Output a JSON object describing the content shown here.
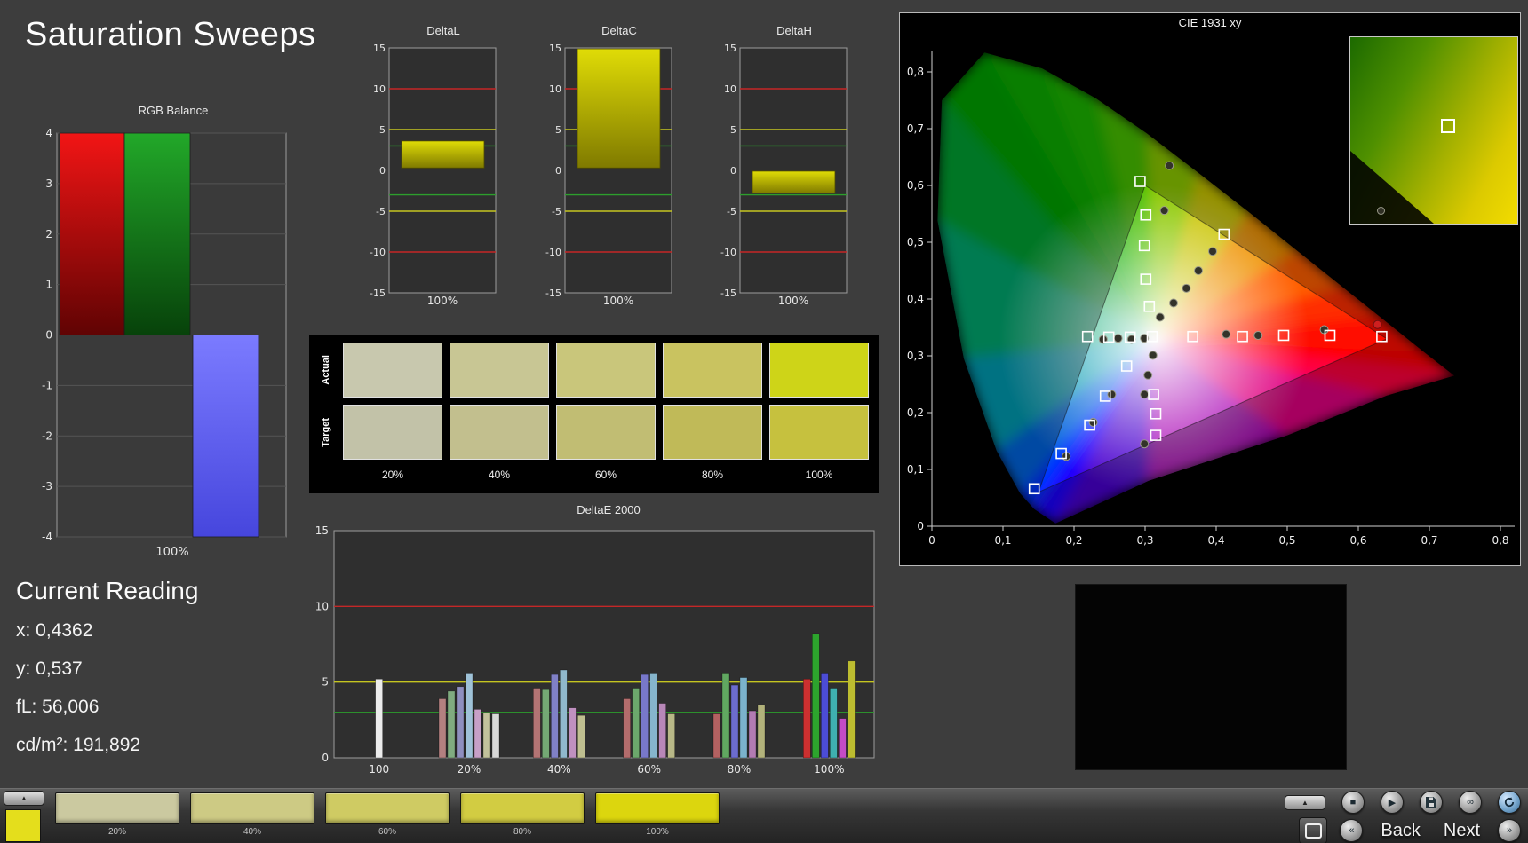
{
  "title": "Saturation Sweeps",
  "current_reading": {
    "heading": "Current Reading",
    "lines": [
      "x: 0,4362",
      "y: 0,537",
      "fL: 56,006",
      "cd/m²: 191,892"
    ]
  },
  "swatch_panel": {
    "row_labels": [
      "Actual",
      "Target"
    ],
    "columns": [
      "20%",
      "40%",
      "60%",
      "80%",
      "100%"
    ],
    "actual_colors": [
      "#c8c8ae",
      "#c8c694",
      "#c9c67b",
      "#c9c360",
      "#ced418"
    ],
    "target_colors": [
      "#c2c2a8",
      "#c2bf8e",
      "#c1bd73",
      "#c0ba58",
      "#c6c13e"
    ]
  },
  "toolbar": {
    "strip_swatches": [
      {
        "label": "20%",
        "color": "#cbc9a0"
      },
      {
        "label": "40%",
        "color": "#cdca84"
      },
      {
        "label": "60%",
        "color": "#cfcb63"
      },
      {
        "label": "80%",
        "color": "#d2cc42"
      },
      {
        "label": "100%",
        "color": "#dcd60e"
      }
    ],
    "selected_color": "#e4de1c",
    "back_label": "Back",
    "next_label": "Next",
    "icons": {
      "eject": "▲",
      "stop": "■",
      "play": "▶",
      "infinity": "∞",
      "back": "«",
      "next": "»"
    },
    "button_names": [
      "eject",
      "stop",
      "play",
      "save",
      "loop",
      "refresh",
      "pattern-window",
      "back",
      "next"
    ]
  },
  "chart_data": [
    {
      "id": "rgb_balance",
      "type": "bar",
      "title": "RGB Balance",
      "categories": [
        "100%"
      ],
      "series": [
        {
          "name": "Red",
          "values": [
            4
          ],
          "color": "#cc1111"
        },
        {
          "name": "Green",
          "values": [
            4
          ],
          "color": "#1a9122"
        },
        {
          "name": "Blue",
          "values": [
            -4
          ],
          "color": "#5a5aff"
        }
      ],
      "ylim": [
        -4,
        4
      ],
      "yticks": [
        4,
        3,
        2,
        1,
        0,
        -1,
        -2,
        -3,
        -4
      ]
    },
    {
      "id": "delta_l",
      "type": "bar",
      "title": "DeltaL",
      "categories": [
        "100%"
      ],
      "value": 3.6,
      "bar_from": 0.3,
      "bar_color": "#c9c400",
      "ylim": [
        -15,
        15
      ],
      "yticks": [
        15,
        10,
        5,
        0,
        -5,
        -10,
        -15
      ],
      "ref_lines": [
        {
          "y": 10,
          "color": "#c52727"
        },
        {
          "y": 5,
          "color": "#c5c520"
        },
        {
          "y": 3,
          "color": "#2d9e2d"
        },
        {
          "y": -3,
          "color": "#2d9e2d"
        },
        {
          "y": -5,
          "color": "#c5c520"
        },
        {
          "y": -10,
          "color": "#c52727"
        }
      ]
    },
    {
      "id": "delta_c",
      "type": "bar",
      "title": "DeltaC",
      "categories": [
        "100%"
      ],
      "value": 16,
      "bar_from": 0.3,
      "bar_color": "#c9c400",
      "ylim": [
        -15,
        15
      ],
      "yticks": [
        15,
        10,
        5,
        0,
        -5,
        -10,
        -15
      ],
      "ref_lines": [
        {
          "y": 10,
          "color": "#c52727"
        },
        {
          "y": 5,
          "color": "#c5c520"
        },
        {
          "y": 3,
          "color": "#2d9e2d"
        },
        {
          "y": -3,
          "color": "#2d9e2d"
        },
        {
          "y": -5,
          "color": "#c5c520"
        },
        {
          "y": -10,
          "color": "#c52727"
        }
      ]
    },
    {
      "id": "delta_h",
      "type": "bar",
      "title": "DeltaH",
      "categories": [
        "100%"
      ],
      "value": -2.8,
      "bar_from": -0.1,
      "bar_color": "#c9c400",
      "ylim": [
        -15,
        15
      ],
      "yticks": [
        15,
        10,
        5,
        0,
        -5,
        -10,
        -15
      ],
      "ref_lines": [
        {
          "y": 10,
          "color": "#c52727"
        },
        {
          "y": 5,
          "color": "#c5c520"
        },
        {
          "y": 3,
          "color": "#2d9e2d"
        },
        {
          "y": -3,
          "color": "#2d9e2d"
        },
        {
          "y": -5,
          "color": "#c5c520"
        },
        {
          "y": -10,
          "color": "#c52727"
        }
      ]
    },
    {
      "id": "deltae2000",
      "type": "bar",
      "title": "DeltaE 2000",
      "ylim": [
        0,
        15
      ],
      "yticks": [
        0,
        5,
        10,
        15
      ],
      "ref_lines": [
        {
          "y": 10,
          "color": "#c52727"
        },
        {
          "y": 5,
          "color": "#c5c520"
        },
        {
          "y": 3,
          "color": "#2d9e2d"
        }
      ],
      "groups": [
        {
          "label": "100",
          "bars": [
            [
              5.2,
              "#ececec"
            ]
          ]
        },
        {
          "label": "20%",
          "bars": [
            [
              3.9,
              "#b38080"
            ],
            [
              4.4,
              "#80ab80"
            ],
            [
              4.7,
              "#8f8fbf"
            ],
            [
              5.6,
              "#9fc2d8"
            ],
            [
              3.2,
              "#c7a0c7"
            ],
            [
              3.0,
              "#c2c29c"
            ],
            [
              2.9,
              "#d8d8d8"
            ]
          ]
        },
        {
          "label": "40%",
          "bars": [
            [
              4.6,
              "#b37474"
            ],
            [
              4.5,
              "#74a874"
            ],
            [
              5.5,
              "#8080c6"
            ],
            [
              5.8,
              "#90b8cc"
            ],
            [
              3.3,
              "#bf90bf"
            ],
            [
              2.8,
              "#bfbf90"
            ]
          ]
        },
        {
          "label": "60%",
          "bars": [
            [
              3.9,
              "#b36c6c"
            ],
            [
              4.6,
              "#6ca86c"
            ],
            [
              5.5,
              "#7878ca"
            ],
            [
              5.6,
              "#86b5cc"
            ],
            [
              3.6,
              "#b887b8"
            ],
            [
              2.9,
              "#b8b887"
            ]
          ]
        },
        {
          "label": "80%",
          "bars": [
            [
              2.9,
              "#b36161"
            ],
            [
              5.6,
              "#61a861"
            ],
            [
              4.8,
              "#6c6cce"
            ],
            [
              5.3,
              "#7bb2cc"
            ],
            [
              3.1,
              "#b27bb2"
            ],
            [
              3.5,
              "#b2b27b"
            ]
          ]
        },
        {
          "label": "100%",
          "bars": [
            [
              5.2,
              "#cc3030"
            ],
            [
              8.2,
              "#2da42d"
            ],
            [
              5.6,
              "#4c4cd6"
            ],
            [
              4.6,
              "#3fb0b0"
            ],
            [
              2.6,
              "#c44cc4"
            ],
            [
              6.4,
              "#bdbd30"
            ]
          ]
        }
      ]
    },
    {
      "id": "cie1931",
      "type": "scatter",
      "title": "CIE 1931 xy",
      "xlim": [
        0,
        0.8
      ],
      "ylim": [
        0,
        0.8
      ],
      "xticks": [
        "0",
        "0,1",
        "0,2",
        "0,3",
        "0,4",
        "0,5",
        "0,6",
        "0,7",
        "0,8"
      ],
      "yticks": [
        "0",
        "0,1",
        "0,2",
        "0,3",
        "0,4",
        "0,5",
        "0,6",
        "0,7",
        "0,8"
      ],
      "gamut_triangle": [
        [
          0.64,
          0.33
        ],
        [
          0.3,
          0.6
        ],
        [
          0.15,
          0.06
        ]
      ],
      "white_point": [
        0.3127,
        0.329
      ],
      "targets": [
        [
          0.293,
          0.607
        ],
        [
          0.301,
          0.548
        ],
        [
          0.299,
          0.494
        ],
        [
          0.301,
          0.435
        ],
        [
          0.306,
          0.387
        ],
        [
          0.219,
          0.334
        ],
        [
          0.249,
          0.333
        ],
        [
          0.279,
          0.333
        ],
        [
          0.31,
          0.334
        ],
        [
          0.367,
          0.334
        ],
        [
          0.437,
          0.334
        ],
        [
          0.495,
          0.336
        ],
        [
          0.56,
          0.336
        ],
        [
          0.633,
          0.334
        ],
        [
          0.411,
          0.514
        ],
        [
          0.274,
          0.282
        ],
        [
          0.312,
          0.232
        ],
        [
          0.315,
          0.198
        ],
        [
          0.244,
          0.229
        ],
        [
          0.222,
          0.178
        ],
        [
          0.182,
          0.128
        ],
        [
          0.144,
          0.066
        ],
        [
          0.315,
          0.16
        ]
      ],
      "measured": [
        [
          0.334,
          0.635
        ],
        [
          0.327,
          0.556
        ],
        [
          0.395,
          0.484
        ],
        [
          0.375,
          0.45
        ],
        [
          0.358,
          0.419
        ],
        [
          0.34,
          0.393
        ],
        [
          0.321,
          0.368
        ],
        [
          0.414,
          0.338
        ],
        [
          0.459,
          0.336
        ],
        [
          0.552,
          0.346
        ],
        [
          0.241,
          0.329
        ],
        [
          0.262,
          0.331
        ],
        [
          0.281,
          0.329
        ],
        [
          0.299,
          0.331
        ],
        [
          0.311,
          0.301
        ],
        [
          0.304,
          0.266
        ],
        [
          0.299,
          0.232
        ],
        [
          0.253,
          0.232
        ],
        [
          0.227,
          0.183
        ],
        [
          0.189,
          0.123
        ],
        [
          0.299,
          0.145
        ]
      ],
      "measured_red": [
        [
          0.627,
          0.355
        ]
      ]
    }
  ]
}
